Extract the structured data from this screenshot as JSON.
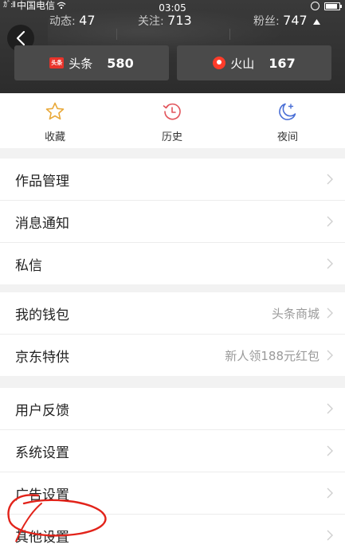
{
  "status_bar": {
    "carrier": "中国电信",
    "time": "03:05"
  },
  "header": {
    "stats": [
      {
        "label": "动态:",
        "value": "47"
      },
      {
        "label": "关注:",
        "value": "713"
      },
      {
        "label": "粉丝:",
        "value": "747"
      }
    ],
    "platforms": [
      {
        "icon_text": "头条",
        "name": "头条",
        "count": "580"
      },
      {
        "name": "火山",
        "count": "167"
      }
    ]
  },
  "quick_actions": [
    {
      "label": "收藏",
      "icon": "star-icon"
    },
    {
      "label": "历史",
      "icon": "history-icon"
    },
    {
      "label": "夜间",
      "icon": "moon-icon"
    }
  ],
  "menu_groups": [
    [
      {
        "title": "作品管理",
        "extra": ""
      },
      {
        "title": "消息通知",
        "extra": ""
      },
      {
        "title": "私信",
        "extra": ""
      }
    ],
    [
      {
        "title": "我的钱包",
        "extra": "头条商城"
      },
      {
        "title": "京东特供",
        "extra": "新人领188元红包"
      }
    ],
    [
      {
        "title": "用户反馈",
        "extra": ""
      },
      {
        "title": "系统设置",
        "extra": ""
      },
      {
        "title": "广告设置",
        "extra": ""
      },
      {
        "title": "其他设置",
        "extra": ""
      }
    ]
  ],
  "colors": {
    "header_bg": "#2c2c2c",
    "page_bg": "#f2f2f2",
    "accent_blue": "#4a6fd6",
    "annotation_red": "#e2231a"
  }
}
